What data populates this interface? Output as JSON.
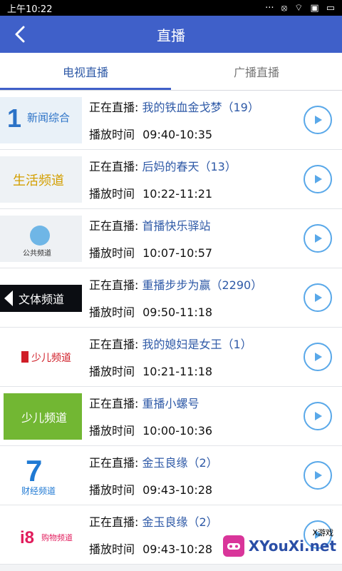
{
  "status_bar": {
    "time": "上午10:22",
    "icons": [
      "signal-dots-icon",
      "silent-icon",
      "wifi-icon",
      "sim-icon",
      "battery-icon"
    ]
  },
  "header": {
    "title": "直播"
  },
  "tabs": [
    {
      "label": "电视直播",
      "active": true
    },
    {
      "label": "广播直播",
      "active": false
    }
  ],
  "labels": {
    "live_prefix": "正在直播:",
    "time_prefix": "播放时间"
  },
  "channels": [
    {
      "logo": "新闻综合",
      "program": "我的铁血金戈梦（19）",
      "time": "09:40-10:35"
    },
    {
      "logo": "生活频道",
      "program": "后妈的春天（13）",
      "time": "10:22-11:21"
    },
    {
      "logo": "公共频道",
      "program": "首播快乐驿站",
      "time": "10:07-10:57"
    },
    {
      "logo": "文体频道",
      "program": "重播步步为赢（2290）",
      "time": "09:50-11:18"
    },
    {
      "logo": "少儿频道",
      "program": "我的媳妇是女王（1）",
      "time": "10:21-11:18"
    },
    {
      "logo": "少儿频道",
      "program": "重播小螺号",
      "time": "10:00-10:36"
    },
    {
      "logo": "财经频道",
      "program": "金玉良缘（2）",
      "time": "09:43-10:28"
    },
    {
      "logo": "购物频道",
      "program": "金玉良缘（2）",
      "time": "09:43-10:28"
    }
  ],
  "watermark": {
    "top": "X游戏",
    "main": "XYouXi.net"
  },
  "colors": {
    "app_bar": "#3f60c9",
    "active_tab": "#2f5aa7",
    "play_ring": "#59a8e9"
  }
}
